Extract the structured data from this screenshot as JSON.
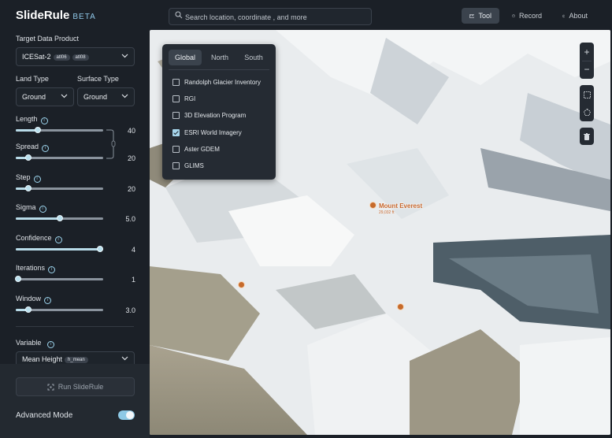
{
  "app": {
    "name": "SlideRule",
    "badge": "BETA"
  },
  "search": {
    "placeholder": "Search location, coordinate , and more"
  },
  "nav": [
    {
      "label": "Tool",
      "icon": "ruler-icon"
    },
    {
      "label": "Record",
      "icon": "record-icon"
    },
    {
      "label": "About",
      "icon": "info-icon"
    }
  ],
  "panel": {
    "target_label": "Target Data Product",
    "target_value": "ICESat-2",
    "target_badges": [
      "atl06",
      "atl08"
    ],
    "land_type_label": "Land Type",
    "land_type_value": "Ground",
    "surface_type_label": "Surface Type",
    "surface_type_value": "Ground",
    "params": [
      {
        "label": "Length",
        "value": "40",
        "level": 0.25
      },
      {
        "label": "Spread",
        "value": "20",
        "level": 0.14
      },
      {
        "label": "Step",
        "value": "20",
        "level": 0.14
      },
      {
        "label": "Sigma",
        "value": "5.0",
        "level": 0.5
      },
      {
        "label": "Confidence",
        "value": "4",
        "level": 0.96
      },
      {
        "label": "Iterations",
        "value": "1",
        "level": 0.03
      },
      {
        "label": "Window",
        "value": "3.0",
        "level": 0.14
      }
    ],
    "variable_label": "Variable",
    "variable_value": "Mean Height",
    "variable_badge": "h_mean",
    "run_label": "Run SlideRule",
    "advanced_label": "Advanced Mode",
    "advanced_on": true
  },
  "layers": {
    "tabs": [
      "Global",
      "North",
      "South"
    ],
    "active_tab": "Global",
    "items": [
      {
        "label": "Randolph Glacier Inventory",
        "checked": false
      },
      {
        "label": "RGI",
        "checked": false
      },
      {
        "label": "3D Elevation Program",
        "checked": false
      },
      {
        "label": "ESRI World Imagery",
        "checked": true
      },
      {
        "label": "Aster GDEM",
        "checked": false
      },
      {
        "label": "GLIMS",
        "checked": false
      }
    ]
  },
  "map": {
    "peaks": [
      {
        "name": "Mount Everest",
        "elevation": "29,032 ft"
      },
      {
        "name": "",
        "elevation": ""
      },
      {
        "name": "",
        "elevation": ""
      }
    ]
  },
  "colors": {
    "accent": "#8dc9e6",
    "background": "#1b2027",
    "panel_surface": "#252b33",
    "peak_marker": "#c6652a"
  }
}
